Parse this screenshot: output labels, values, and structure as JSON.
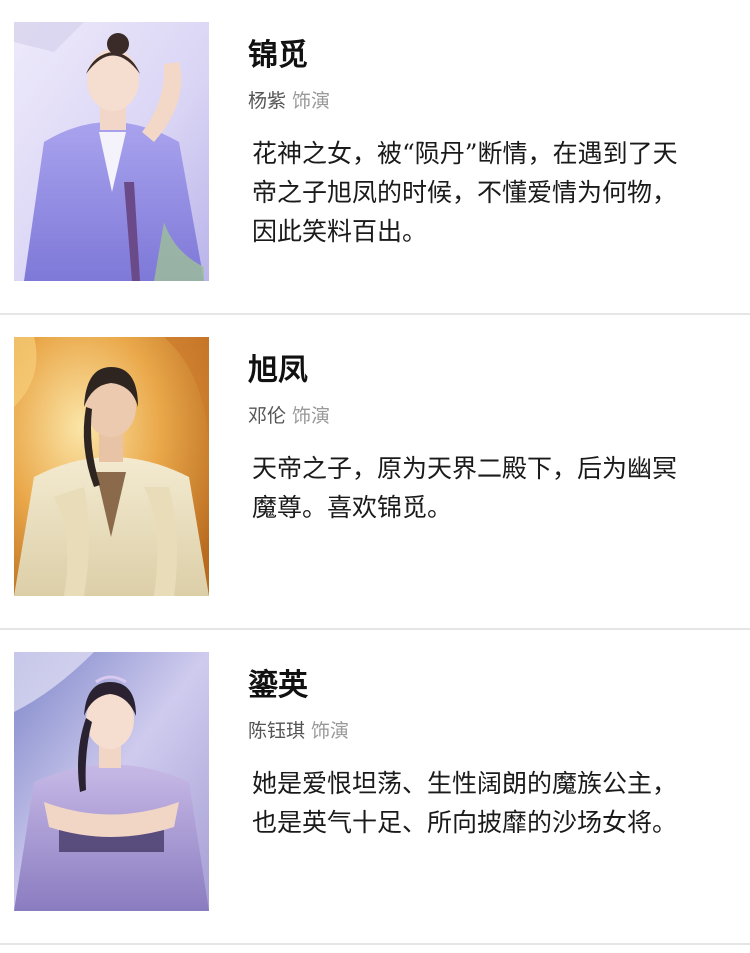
{
  "role_word": "饰演",
  "characters": [
    {
      "name": "锦觅",
      "actor": "杨紫",
      "description": "花神之女，被“陨丹”断情，在遇到了天帝之子旭凤的时候，不懂爱情为何物，因此笑料百出。",
      "portrait_palette": [
        "#c9c4f2",
        "#eee9fb",
        "#8a86d8"
      ]
    },
    {
      "name": "旭凤",
      "actor": "邓伦",
      "description": "天帝之子，原为天界二殿下，后为幽冥魔尊。喜欢锦觅。",
      "portrait_palette": [
        "#d98a2a",
        "#f7d98f",
        "#efe4c6"
      ]
    },
    {
      "name": "鎏英",
      "actor": "陈钰琪",
      "description": "她是爱恨坦荡、生性阔朗的魔族公主，也是英气十足、所向披靡的沙场女将。",
      "portrait_palette": [
        "#8e8fd0",
        "#d7d3ee",
        "#6a5fa3"
      ]
    }
  ]
}
